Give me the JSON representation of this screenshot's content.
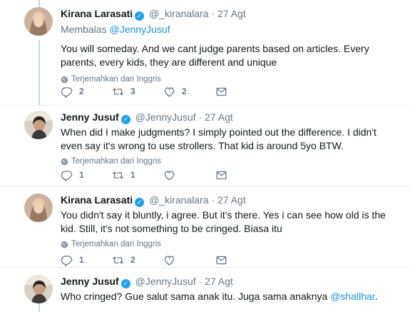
{
  "tweets": [
    {
      "name": "Kirana Larasati",
      "verified_mark": "✓",
      "handle": "@_kiranalara",
      "dot": "·",
      "time": "27 Agt",
      "reply_prefix": "Membalas",
      "reply_mention": "@JennyJusuf",
      "text": "You will someday. And we cant judge parents based on articles. Every parents, every kids, they are different and unique",
      "translate": "Terjemahkan dari Inggris",
      "replies": "2",
      "retweets": "3",
      "likes": "2"
    },
    {
      "name": "Jenny Jusuf",
      "verified_mark": "✓",
      "handle": "@JennyJusuf",
      "dot": "·",
      "time": "27 Agt",
      "text": "When did I make judgments? I simply pointed out the difference. I didn't even say it's wrong to use strollers. That kid is around 5yo BTW.",
      "translate": "Terjemahkan dari Inggris",
      "replies": "1",
      "retweets": "1",
      "likes": ""
    },
    {
      "name": "Kirana Larasati",
      "verified_mark": "✓",
      "handle": "@_kiranalara",
      "dot": "·",
      "time": "27 Agt",
      "text": "You didn't say it bluntly, i agree. But it's there. Yes i can see how old is the kid. Still, it's not something to be cringed. Biasa itu",
      "translate": "Terjemahkan dari Inggris",
      "replies": "1",
      "retweets": "2",
      "likes": ""
    },
    {
      "name": "Jenny Jusuf",
      "verified_mark": "✓",
      "handle": "@JennyJusuf",
      "dot": "·",
      "time": "27 Agt",
      "text_before": "Who cringed? Gue salut sama anak itu. Juga sama anaknya ",
      "text_mention": "@shallhar",
      "text_after": "."
    }
  ],
  "icons": {
    "reply": "reply-icon",
    "retweet": "retweet-icon",
    "like": "heart-icon",
    "dm": "envelope-icon",
    "translate": "globe-icon",
    "verified": "verified-badge-icon"
  },
  "colors": {
    "link": "#1b95e0",
    "verified": "#1da1f2",
    "muted": "#657786"
  }
}
